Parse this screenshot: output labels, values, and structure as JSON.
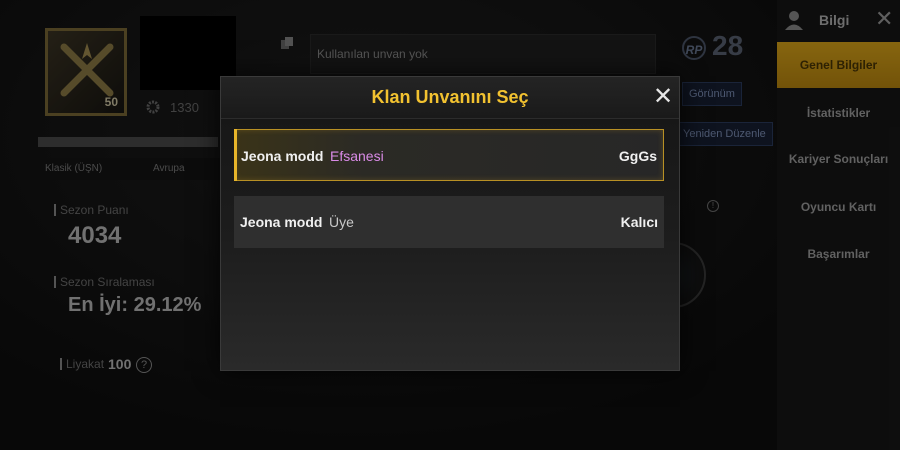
{
  "profile": {
    "level": "50",
    "coins": "1330",
    "title_placeholder": "Kullanılan unvan yok",
    "rp_label": "RP",
    "rp_value": "28",
    "view_button": "Görünüm",
    "edit_button": "Yeniden Düzenle",
    "mode": "Klasik (ÜŞN)",
    "region": "Avrupa",
    "season_points_label": "Sezon Puanı",
    "season_points_value": "4034",
    "season_rank_label": "Sezon Sıralaması",
    "season_rank_value": "En İyi: 29.12%",
    "merit_label": "Liyakat",
    "merit_value": "100"
  },
  "sidebar": {
    "title": "Bilgi",
    "items": [
      {
        "label": "Genel Bilgiler",
        "active": true
      },
      {
        "label": "İstatistikler",
        "active": false
      },
      {
        "label": "Kariyer Sonuçları",
        "active": false
      },
      {
        "label": "Oyuncu Kartı",
        "active": false
      },
      {
        "label": "Başarımlar",
        "active": false
      }
    ]
  },
  "modal": {
    "title": "Klan Unvanını Seç",
    "options": [
      {
        "name": "Jeona modd",
        "rank": "Efsanesi",
        "tag": "GgGs",
        "selected": true,
        "rank_color": "#d98be6"
      },
      {
        "name": "Jeona modd",
        "rank": "Üye",
        "tag": "Kalıcı",
        "selected": false,
        "rank_color": "#c9c9c9"
      }
    ]
  },
  "colors": {
    "accent_gold": "#f2c230",
    "sidebar_active": "#d9a419",
    "selected_border": "#b89024"
  }
}
